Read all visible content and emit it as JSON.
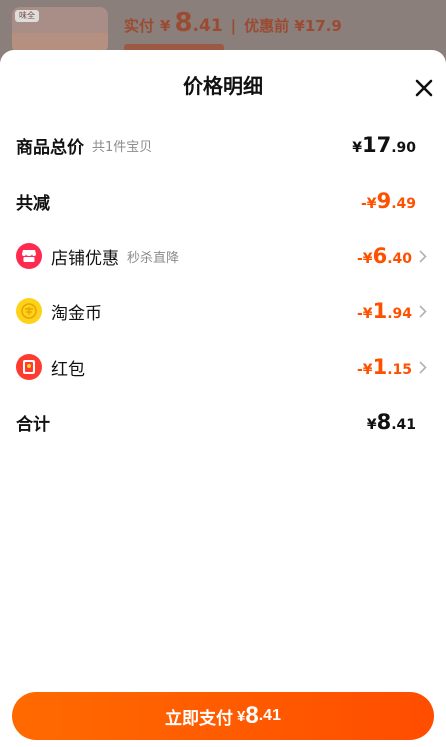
{
  "backdrop": {
    "thumb_tag": "味全",
    "price_label": "实付",
    "price_currency": "¥",
    "price_int": "8",
    "price_dec": ".41",
    "separator": "|",
    "original_price": "优惠前 ¥17.9"
  },
  "sheet": {
    "title": "价格明细",
    "rows": [
      {
        "label": "商品总价",
        "sub": "共1件宝贝",
        "currency": "¥",
        "int": "17",
        "dec": ".90"
      },
      {
        "label": "共减",
        "sub": "",
        "currency": "-¥",
        "int": "9",
        "dec": ".49"
      },
      {
        "label": "店铺优惠",
        "sub": "秒杀直降",
        "currency": "-¥",
        "int": "6",
        "dec": ".40"
      },
      {
        "label": "淘金币",
        "sub": "",
        "currency": "-¥",
        "int": "1",
        "dec": ".94"
      },
      {
        "label": "红包",
        "sub": "",
        "currency": "-¥",
        "int": "1",
        "dec": ".15"
      },
      {
        "label": "合计",
        "sub": "",
        "currency": "¥",
        "int": "8",
        "dec": ".41"
      }
    ]
  },
  "pay_button": {
    "label": "立即支付",
    "currency": "¥",
    "int": "8",
    "dec": ".41"
  },
  "colors": {
    "accent": "#ff5000",
    "shop_icon": "#ff2a4f",
    "coin_icon": "#ffd21a",
    "redpacket_icon": "#ff3b30"
  },
  "icons": {
    "shop": "shop-icon",
    "coin": "coin-icon",
    "redpacket": "red-packet-icon",
    "close": "close-icon",
    "chevron": "chevron-right-icon"
  }
}
